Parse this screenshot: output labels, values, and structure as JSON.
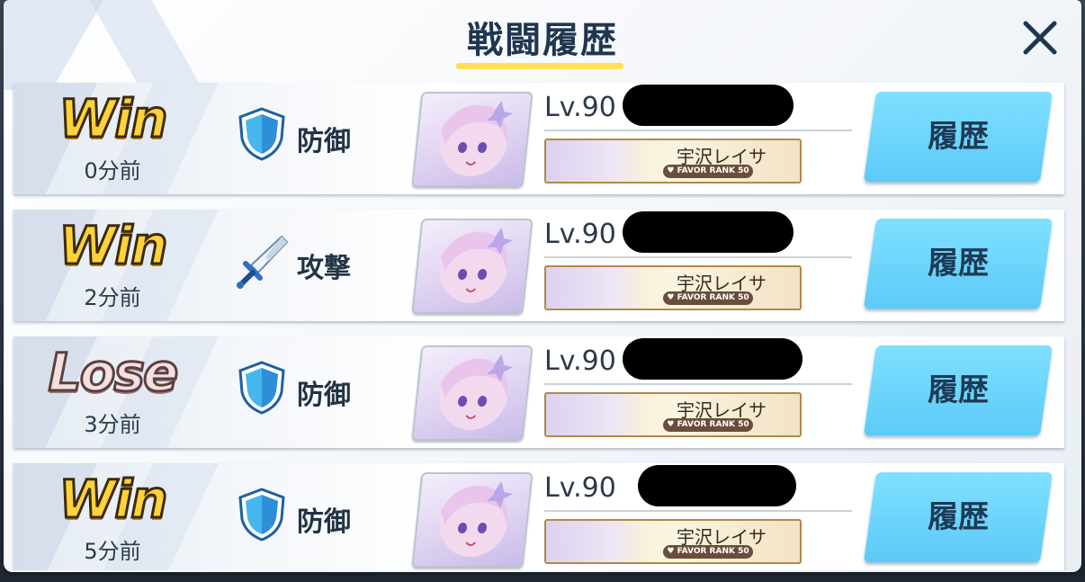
{
  "dialog": {
    "title": "戦闘履歴",
    "close_icon": "close-icon"
  },
  "colors": {
    "accent_yellow": "#ffe05a",
    "button_blue": "#63cff9",
    "win_gold": "#ffd23a",
    "lose_pink": "#f4dede"
  },
  "history": [
    {
      "result": "Win",
      "time": "0分前",
      "type": "防御",
      "type_icon": "shield-icon",
      "level": "Lv.90",
      "banner_name": "宇沢レイサ",
      "favor": "FAVOR RANK 50",
      "button": "履歴"
    },
    {
      "result": "Win",
      "time": "2分前",
      "type": "攻撃",
      "type_icon": "sword-icon",
      "level": "Lv.90",
      "banner_name": "宇沢レイサ",
      "favor": "FAVOR RANK 50",
      "button": "履歴"
    },
    {
      "result": "Lose",
      "time": "3分前",
      "type": "防御",
      "type_icon": "shield-icon",
      "level": "Lv.90",
      "banner_name": "宇沢レイサ",
      "favor": "FAVOR RANK 50",
      "button": "履歴"
    },
    {
      "result": "Win",
      "time": "5分前",
      "type": "防御",
      "type_icon": "shield-icon",
      "level": "Lv.90",
      "banner_name": "宇沢レイサ",
      "favor": "FAVOR RANK 50",
      "button": "履歴"
    }
  ]
}
